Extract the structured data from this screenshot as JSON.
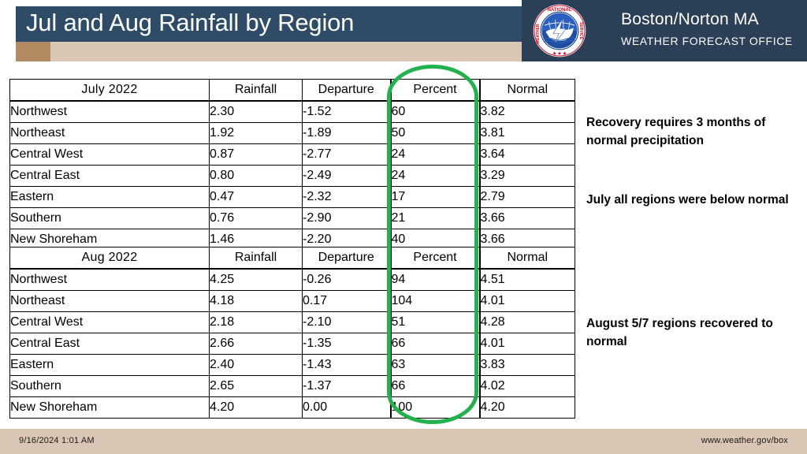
{
  "header": {
    "title": "Jul and Aug Rainfall by Region",
    "brand_title": "Boston/Norton MA",
    "brand_subtitle": "WEATHER FORECAST OFFICE",
    "logo_name": "nws-seal-logo",
    "title_bar_color": "#2e4b67",
    "brand_panel_color": "#2b3f57",
    "tan_strip_color": "#d9c6b4",
    "tan_square_color": "#b48a62"
  },
  "highlight": {
    "name": "percent-column-highlight",
    "color": "#22b14c",
    "target_column": "Percent"
  },
  "tables": [
    {
      "id": "july",
      "period_label": "July 2022",
      "columns": [
        "Rainfall",
        "Departure",
        "Percent",
        "Normal"
      ],
      "rows": [
        {
          "region": "Northwest",
          "rainfall": "2.30",
          "departure": "-1.52",
          "percent": "60",
          "normal": "3.82"
        },
        {
          "region": "Northeast",
          "rainfall": "1.92",
          "departure": "-1.89",
          "percent": "50",
          "normal": "3.81"
        },
        {
          "region": "Central West",
          "rainfall": "0.87",
          "departure": "-2.77",
          "percent": "24",
          "normal": "3.64"
        },
        {
          "region": "Central East",
          "rainfall": "0.80",
          "departure": "-2.49",
          "percent": "24",
          "normal": "3.29"
        },
        {
          "region": "Eastern",
          "rainfall": "0.47",
          "departure": "-2.32",
          "percent": "17",
          "normal": "2.79"
        },
        {
          "region": "Southern",
          "rainfall": "0.76",
          "departure": "-2.90",
          "percent": "21",
          "normal": "3.66"
        },
        {
          "region": "New Shoreham",
          "rainfall": "1.46",
          "departure": "-2.20",
          "percent": "40",
          "normal": "3.66"
        }
      ]
    },
    {
      "id": "aug",
      "period_label": "Aug 2022",
      "columns": [
        "Rainfall",
        "Departure",
        "Percent",
        "Normal"
      ],
      "rows": [
        {
          "region": "Northwest",
          "rainfall": "4.25",
          "departure": "-0.26",
          "percent": "94",
          "normal": "4.51"
        },
        {
          "region": "Northeast",
          "rainfall": "4.18",
          "departure": "0.17",
          "percent": "104",
          "normal": "4.01"
        },
        {
          "region": "Central West",
          "rainfall": "2.18",
          "departure": "-2.10",
          "percent": "51",
          "normal": "4.28"
        },
        {
          "region": "Central East",
          "rainfall": "2.66",
          "departure": "-1.35",
          "percent": "66",
          "normal": "4.01"
        },
        {
          "region": "Eastern",
          "rainfall": "2.40",
          "departure": "-1.43",
          "percent": "63",
          "normal": "3.83"
        },
        {
          "region": "Southern",
          "rainfall": "2.65",
          "departure": "-1.37",
          "percent": "66",
          "normal": "4.02"
        },
        {
          "region": "New Shoreham",
          "rainfall": "4.20",
          "departure": "0.00",
          "percent": "100",
          "normal": "4.20"
        }
      ]
    }
  ],
  "annotations": {
    "note_1": "Recovery requires 3 months of normal precipitation",
    "note_2": "July all regions were below normal",
    "note_3": "August 5/7 regions recovered to normal"
  },
  "footer": {
    "timestamp": "9/16/2024 1:01 AM",
    "website": "www.weather.gov/box"
  }
}
